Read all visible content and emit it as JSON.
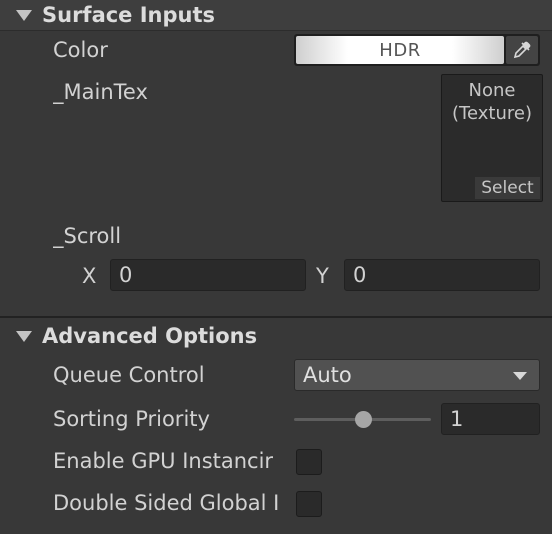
{
  "surface_inputs": {
    "title": "Surface Inputs",
    "color": {
      "label": "Color",
      "mode": "HDR",
      "eyedropper_icon": "eyedropper-icon"
    },
    "main_tex": {
      "label": "_MainTex",
      "value_line1": "None",
      "value_line2": "(Texture)",
      "select_label": "Select"
    },
    "scroll": {
      "label": "_Scroll",
      "x_label": "X",
      "x_value": "0",
      "y_label": "Y",
      "y_value": "0"
    }
  },
  "advanced_options": {
    "title": "Advanced Options",
    "queue_control": {
      "label": "Queue Control",
      "value": "Auto"
    },
    "sorting_priority": {
      "label": "Sorting Priority",
      "value": "1",
      "slider_fraction": 0.5
    },
    "gpu_instancing": {
      "label": "Enable GPU Instancir",
      "checked": false
    },
    "double_sided": {
      "label": "Double Sided Global I",
      "checked": false
    }
  }
}
